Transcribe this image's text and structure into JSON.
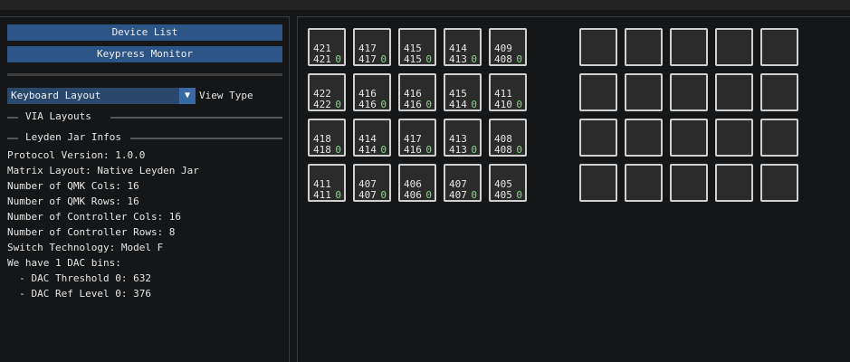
{
  "buttons": {
    "device_list": "Device List",
    "keypress_monitor": "Keypress Monitor"
  },
  "view_type": {
    "selected": "Keyboard Layout",
    "label": "View Type"
  },
  "headers": {
    "via_layouts": "VIA Layouts",
    "leyden_jar_infos": "Leyden Jar Infos"
  },
  "info_lines": [
    "Protocol Version: 1.0.0",
    "Matrix Layout: Native Leyden Jar",
    "Number of QMK Cols: 16",
    "Number of QMK Rows: 16",
    "Number of Controller Cols: 16",
    "Number of Controller Rows: 8",
    "Switch Technology: Model F",
    "We have 1 DAC bins:",
    "  - DAC Threshold 0: 632",
    "  - DAC Ref Level 0: 376"
  ],
  "key_grid_left": [
    [
      [
        "421",
        "421",
        "0"
      ],
      [
        "417",
        "417",
        "0"
      ],
      [
        "415",
        "415",
        "0"
      ],
      [
        "414",
        "413",
        "0"
      ],
      [
        "409",
        "408",
        "0"
      ]
    ],
    [
      [
        "422",
        "422",
        "0"
      ],
      [
        "416",
        "416",
        "0"
      ],
      [
        "416",
        "416",
        "0"
      ],
      [
        "415",
        "414",
        "0"
      ],
      [
        "411",
        "410",
        "0"
      ]
    ],
    [
      [
        "418",
        "418",
        "0"
      ],
      [
        "414",
        "414",
        "0"
      ],
      [
        "417",
        "416",
        "0"
      ],
      [
        "413",
        "413",
        "0"
      ],
      [
        "408",
        "408",
        "0"
      ]
    ],
    [
      [
        "411",
        "411",
        "0"
      ],
      [
        "407",
        "407",
        "0"
      ],
      [
        "406",
        "406",
        "0"
      ],
      [
        "407",
        "407",
        "0"
      ],
      [
        "405",
        "405",
        "0"
      ]
    ]
  ],
  "key_grid_right": {
    "rows": 4,
    "cols": 5
  }
}
